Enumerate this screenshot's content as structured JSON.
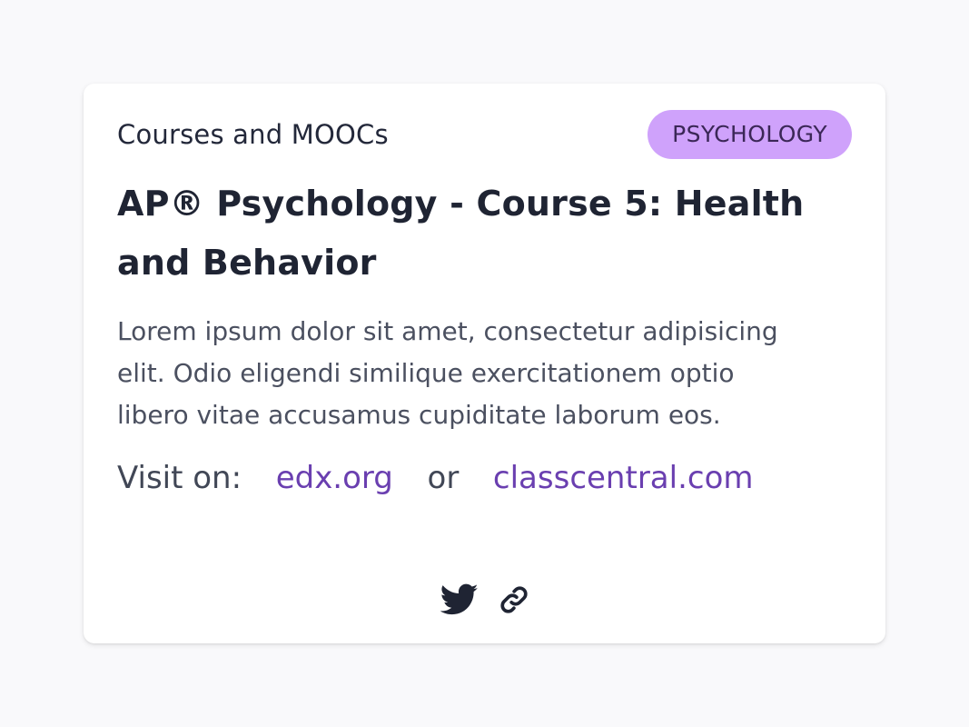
{
  "card": {
    "category": "Courses and MOOCs",
    "tag": "PSYCHOLOGY",
    "title": "AP® Psychology - Course 5: Health and Behavior",
    "description": "Lorem ipsum dolor sit amet, consectetur adipisicing elit. Odio eligendi similique exercitationem optio libero vitae accusamus cupiditate laborum eos.",
    "visit_label": "Visit on:",
    "link_1": "edx.org",
    "or_label": "or",
    "link_2": "classcentral.com",
    "share_icons": [
      "twitter-icon",
      "link-icon"
    ]
  },
  "colors": {
    "background": "#f9f9fb",
    "card": "#ffffff",
    "tag_background": "#cfa2fb",
    "link": "#6a3fb0",
    "title": "#1f2433"
  }
}
